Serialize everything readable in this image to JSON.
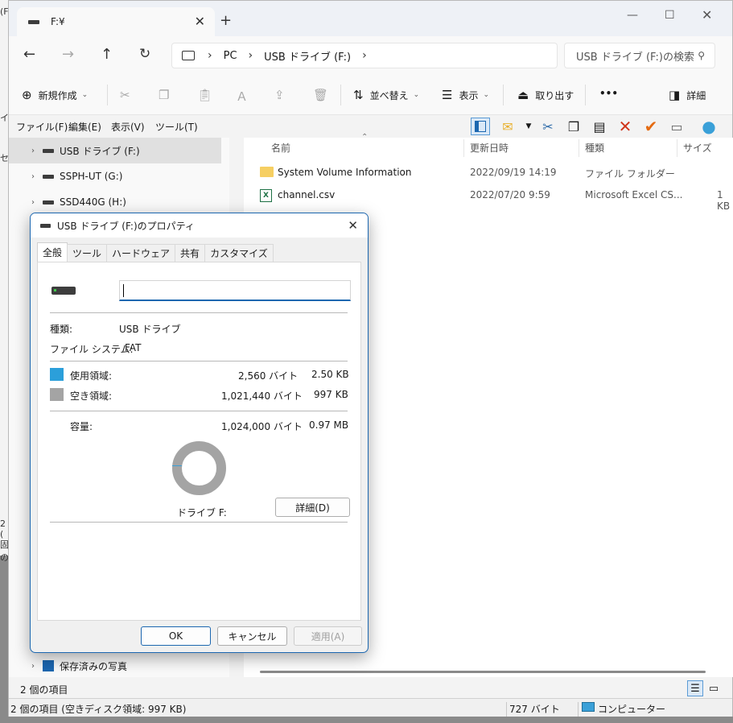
{
  "explorer": {
    "tab_title": "F:¥",
    "address": [
      "PC",
      "USB ドライブ (F:)"
    ],
    "search_placeholder": "USB ドライブ (F:)の検索",
    "commands": {
      "new": "新規作成",
      "sort": "並べ替え",
      "view": "表示",
      "eject": "取り出す",
      "more": "•••",
      "details": "詳細"
    },
    "menus": [
      "ファイル(F)",
      "編集(E)",
      "表示(V)",
      "ツール(T)"
    ],
    "nav_items": [
      {
        "label": "USB ドライブ (F:)",
        "selected": true
      },
      {
        "label": "SSPH-UT (G:)",
        "selected": false
      },
      {
        "label": "SSD440G (H:)",
        "selected": false
      },
      {
        "label": "保存済みの写真",
        "selected": false
      }
    ],
    "columns": {
      "name": "名前",
      "modified": "更新日時",
      "type": "種類",
      "size": "サイズ"
    },
    "files": [
      {
        "name": "System Volume Information",
        "modified": "2022/09/19 14:19",
        "type": "ファイル フォルダー",
        "size": "",
        "icon": "folder-icon"
      },
      {
        "name": "channel.csv",
        "modified": "2022/07/20 9:59",
        "type": "Microsoft Excel CS...",
        "size": "1 KB",
        "icon": "excel-icon"
      }
    ],
    "item_count": "2 個の項目",
    "status_left": "2 個の項目 (空きディスク領域: 997 KB)",
    "status_size": "727 バイト",
    "status_computer": "コンピューター"
  },
  "dialog": {
    "title": "USB ドライブ (F:)のプロパティ",
    "tabs": [
      "全般",
      "ツール",
      "ハードウェア",
      "共有",
      "カスタマイズ"
    ],
    "type_label": "種類:",
    "type_value": "USB ドライブ",
    "fs_label": "ファイル システム:",
    "fs_value": "FAT",
    "used_label": "使用領域:",
    "used_bytes": "2,560 バイト",
    "used_size": "2.50 KB",
    "free_label": "空き領域:",
    "free_bytes": "1,021,440 バイト",
    "free_size": "997 KB",
    "capacity_label": "容量:",
    "capacity_bytes": "1,024,000 バイト",
    "capacity_size": "0.97 MB",
    "drive_label": "ドライブ F:",
    "details_button": "詳細(D)",
    "ok": "OK",
    "cancel": "キャンセル",
    "apply": "適用(A)",
    "colors": {
      "used": "#2b9fda",
      "free": "#a4a4a4"
    }
  },
  "bg_fragments": [
    "(F",
    "イ",
    "セ",
    "2 (",
    "固の"
  ]
}
